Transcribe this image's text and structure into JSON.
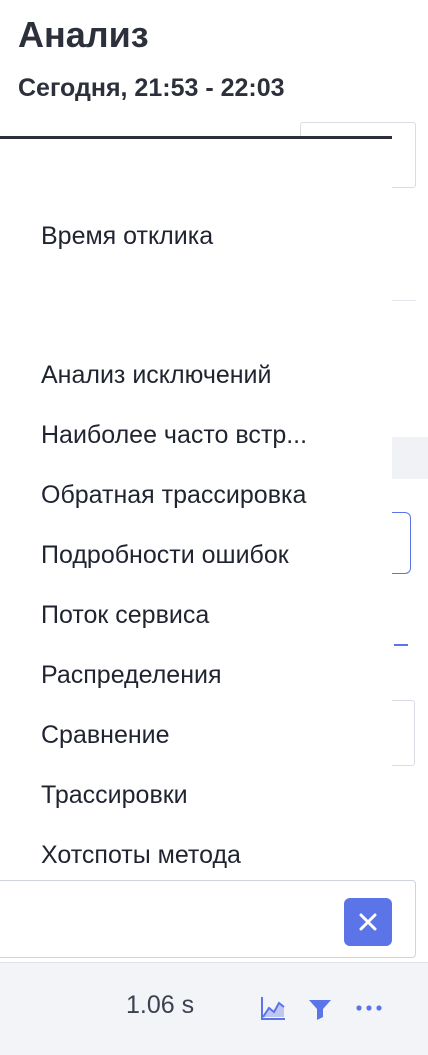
{
  "header": {
    "title": "Анализ",
    "time_range": "Сегодня, 21:53 - 22:03"
  },
  "dropdown": {
    "items": [
      {
        "label": "Время отклика"
      },
      {
        "label": "Анализ исключений"
      },
      {
        "label": "Наиболее часто встр..."
      },
      {
        "label": "Обратная трассировка"
      },
      {
        "label": "Подробности ошибок"
      },
      {
        "label": "Поток сервиса"
      },
      {
        "label": "Распределения"
      },
      {
        "label": "Сравнение"
      },
      {
        "label": "Трассировки"
      },
      {
        "label": "Хотспоты метода"
      }
    ]
  },
  "close_button": {
    "icon": "close-icon"
  },
  "footer": {
    "value": "1.06 s",
    "icons": [
      "area-chart-icon",
      "filter-icon",
      "more-icon"
    ]
  },
  "colors": {
    "accent": "#5b74e8",
    "text": "#1f2430",
    "footer_bg": "#f3f4f7"
  }
}
